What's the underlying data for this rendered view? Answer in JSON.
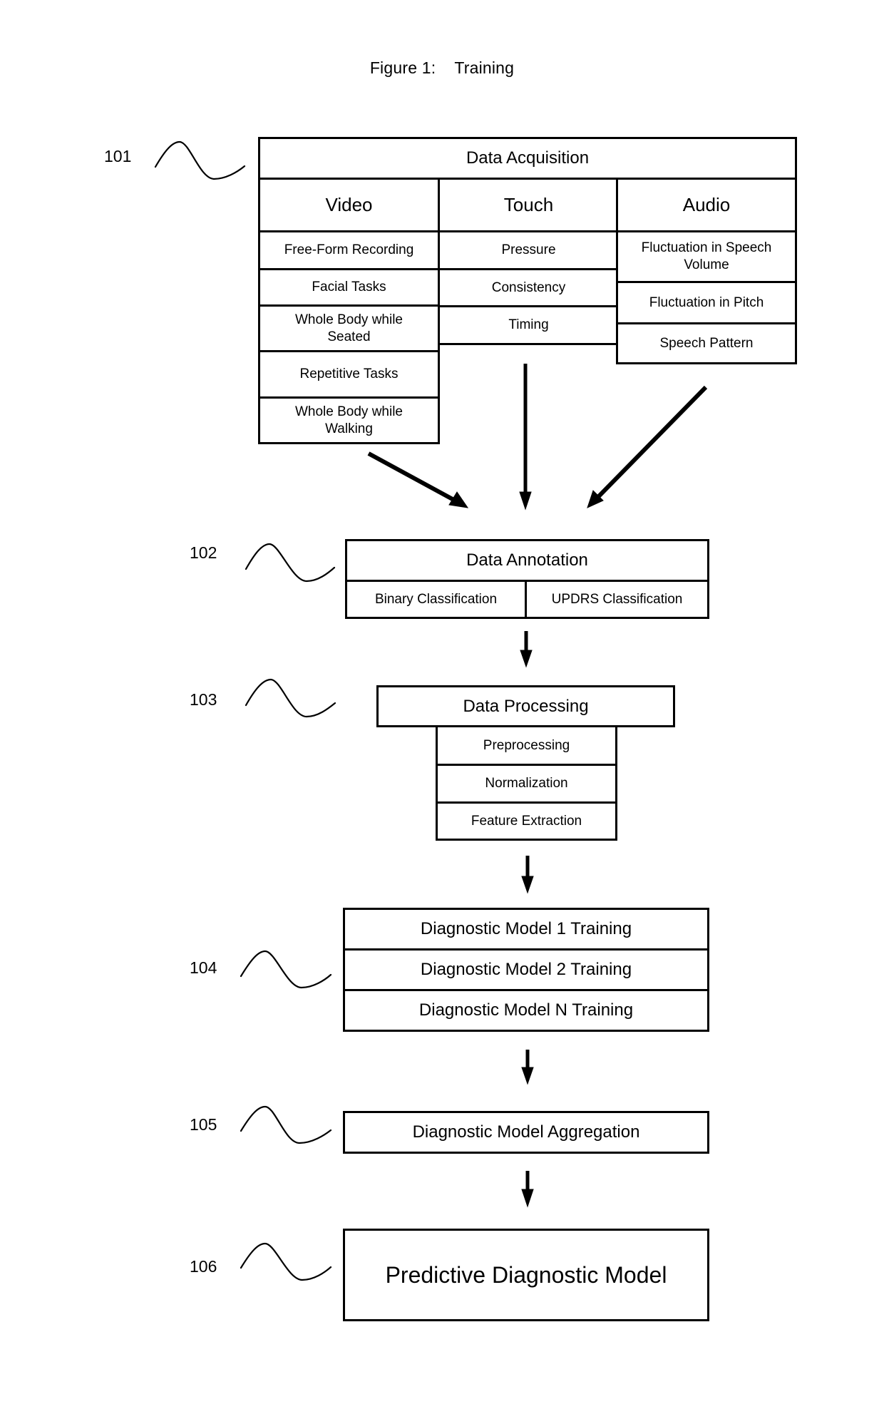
{
  "figure": {
    "title": "Figure 1:    Training"
  },
  "steps": {
    "data_acquisition": {
      "ref": "101",
      "title": "Data Acquisition",
      "columns": [
        {
          "header": "Video",
          "items": [
            "Free-Form Recording",
            "Facial Tasks",
            "Whole Body while Seated",
            "Repetitive Tasks",
            "Whole Body while Walking"
          ]
        },
        {
          "header": "Touch",
          "items": [
            "Pressure",
            "Consistency",
            "Timing"
          ]
        },
        {
          "header": "Audio",
          "items": [
            "Fluctuation in Speech Volume",
            "Fluctuation in Pitch",
            "Speech Pattern"
          ]
        }
      ]
    },
    "data_annotation": {
      "ref": "102",
      "title": "Data Annotation",
      "items": [
        "Binary Classification",
        "UPDRS Classification"
      ]
    },
    "data_processing": {
      "ref": "103",
      "title": "Data Processing",
      "items": [
        "Preprocessing",
        "Normalization",
        "Feature Extraction"
      ]
    },
    "model_training": {
      "ref": "104",
      "items": [
        "Diagnostic Model 1 Training",
        "Diagnostic Model 2 Training",
        "Diagnostic Model N Training"
      ]
    },
    "model_aggregation": {
      "ref": "105",
      "title": "Diagnostic Model Aggregation"
    },
    "predictive_model": {
      "ref": "106",
      "title": "Predictive Diagnostic Model"
    }
  }
}
